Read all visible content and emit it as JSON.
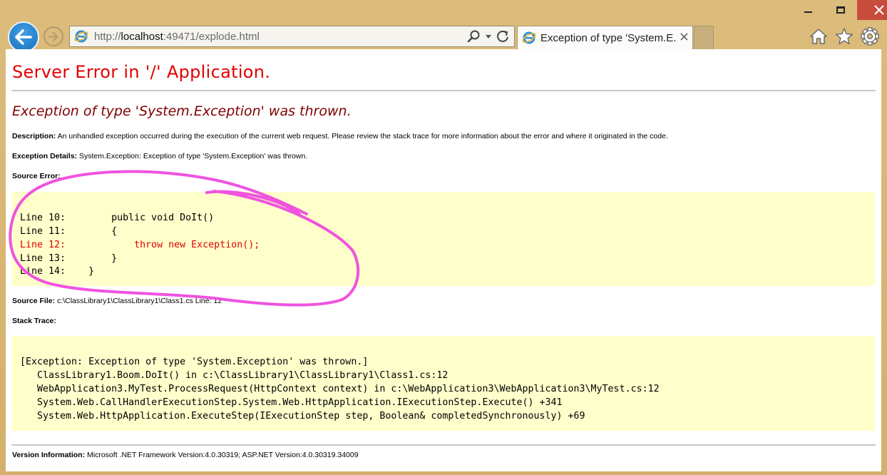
{
  "window": {
    "controls": [
      "minimize",
      "maximize",
      "close"
    ]
  },
  "navbar": {
    "url_prefix": "http://",
    "url_host": "localhost",
    "url_rest": ":49471/explode.html",
    "tab_title": "Exception of type 'System.E...",
    "icons": [
      "back-arrow-icon",
      "forward-arrow-icon",
      "ie-logo-icon",
      "search-icon",
      "dropdown-icon",
      "refresh-icon",
      "close-icon",
      "home-icon",
      "favorites-star-icon",
      "settings-gear-icon"
    ]
  },
  "page": {
    "app_title": "Server Error in '/' Application.",
    "exception_title": "Exception of type 'System.Exception' was thrown.",
    "description_label": "Description:",
    "description_text": "An unhandled exception occurred during the execution of the current web request. Please review the stack trace for more information about the error and where it originated in the code.",
    "details_label": "Exception Details:",
    "details_text": "System.Exception: Exception of type 'System.Exception' was thrown.",
    "source_error_label": "Source Error:",
    "source_lines": [
      "Line 10:        public void DoIt()",
      "Line 11:        {",
      "Line 12:            throw new Exception();",
      "Line 13:        }",
      "Line 14:    }"
    ],
    "error_line_index": 2,
    "source_file_label": "Source File:",
    "source_file_text": "c:\\ClassLibrary1\\ClassLibrary1\\Class1.cs    Line: 12",
    "stack_trace_label": "Stack Trace:",
    "stack_lines": [
      "[Exception: Exception of type 'System.Exception' was thrown.]",
      "   ClassLibrary1.Boom.DoIt() in c:\\ClassLibrary1\\ClassLibrary1\\Class1.cs:12",
      "   WebApplication3.MyTest.ProcessRequest(HttpContext context) in c:\\WebApplication3\\WebApplication3\\MyTest.cs:12",
      "   System.Web.CallHandlerExecutionStep.System.Web.HttpApplication.IExecutionStep.Execute() +341",
      "   System.Web.HttpApplication.ExecuteStep(IExecutionStep step, Boolean& completedSynchronously) +69"
    ],
    "version_label": "Version Information:",
    "version_text": "Microsoft .NET Framework Version:4.0.30319; ASP.NET Version:4.0.30319.34009"
  },
  "colors": {
    "error_red": "#e20000",
    "exception_maroon": "#800000",
    "code_background": "#ffffcc",
    "annotation_magenta": "#ee44dd",
    "frame_tan": "#d8b874",
    "close_button": "#c74c3c"
  }
}
